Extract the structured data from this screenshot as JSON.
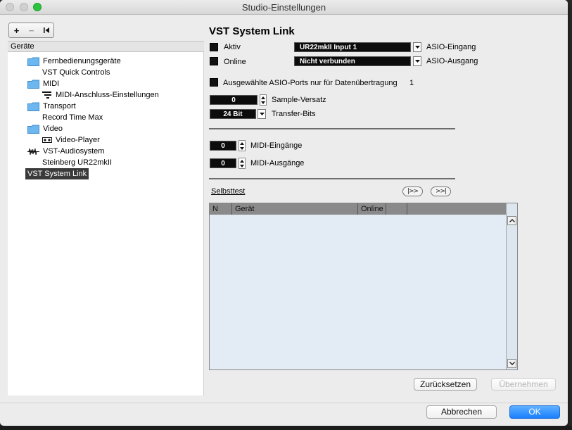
{
  "window": {
    "title": "Studio-Einstellungen"
  },
  "toolbar": {
    "add": "+",
    "remove": "−"
  },
  "left": {
    "header": "Geräte",
    "items": [
      {
        "label": "Fernbedienungsgeräte",
        "icon": "folder-icon"
      },
      {
        "label": "VST Quick Controls",
        "icon": ""
      },
      {
        "label": "MIDI",
        "icon": "folder-icon"
      },
      {
        "label": "MIDI-Anschluss-Einstellungen",
        "icon": "midi-port-icon"
      },
      {
        "label": "Transport",
        "icon": "folder-icon"
      },
      {
        "label": "Record Time Max",
        "icon": ""
      },
      {
        "label": "Video",
        "icon": "folder-icon"
      },
      {
        "label": "Video-Player",
        "icon": "video-player-icon"
      },
      {
        "label": "VST-Audiosystem",
        "icon": "audio-system-icon"
      },
      {
        "label": "Steinberg UR22mkII",
        "icon": ""
      },
      {
        "label": "VST System Link",
        "icon": "",
        "selected": true
      }
    ]
  },
  "panel": {
    "title": "VST System Link",
    "aktiv_label": "Aktiv",
    "online_label": "Online",
    "asio_in_value": "UR22mkII Input 1",
    "asio_in_label": "ASIO-Eingang",
    "asio_out_value": "Nicht verbunden",
    "asio_out_label": "ASIO-Ausgang",
    "selected_ports_label": "Ausgewählte ASIO-Ports nur für Datenübertragung",
    "selected_ports_value": "1",
    "sample_offset_value": "0",
    "sample_offset_label": "Sample-Versatz",
    "transfer_bits_value": "24 Bit",
    "transfer_bits_label": "Transfer-Bits",
    "midi_in_value": "0",
    "midi_in_label": "MIDI-Eingänge",
    "midi_out_value": "0",
    "midi_out_label": "MIDI-Ausgänge",
    "selftest_label": "Selbsttest",
    "pill1": "|>>",
    "pill2": ">>|",
    "table": {
      "columns": [
        "N",
        "Gerät",
        "Online",
        "",
        ""
      ]
    },
    "reset_label": "Zurücksetzen",
    "apply_label": "Übernehmen"
  },
  "footer": {
    "cancel_label": "Abbrechen",
    "ok_label": "OK"
  },
  "colors": {
    "accent": "#1a7fff",
    "selected_bg": "#3a3a3a",
    "table_bg": "#e3ebf4"
  }
}
